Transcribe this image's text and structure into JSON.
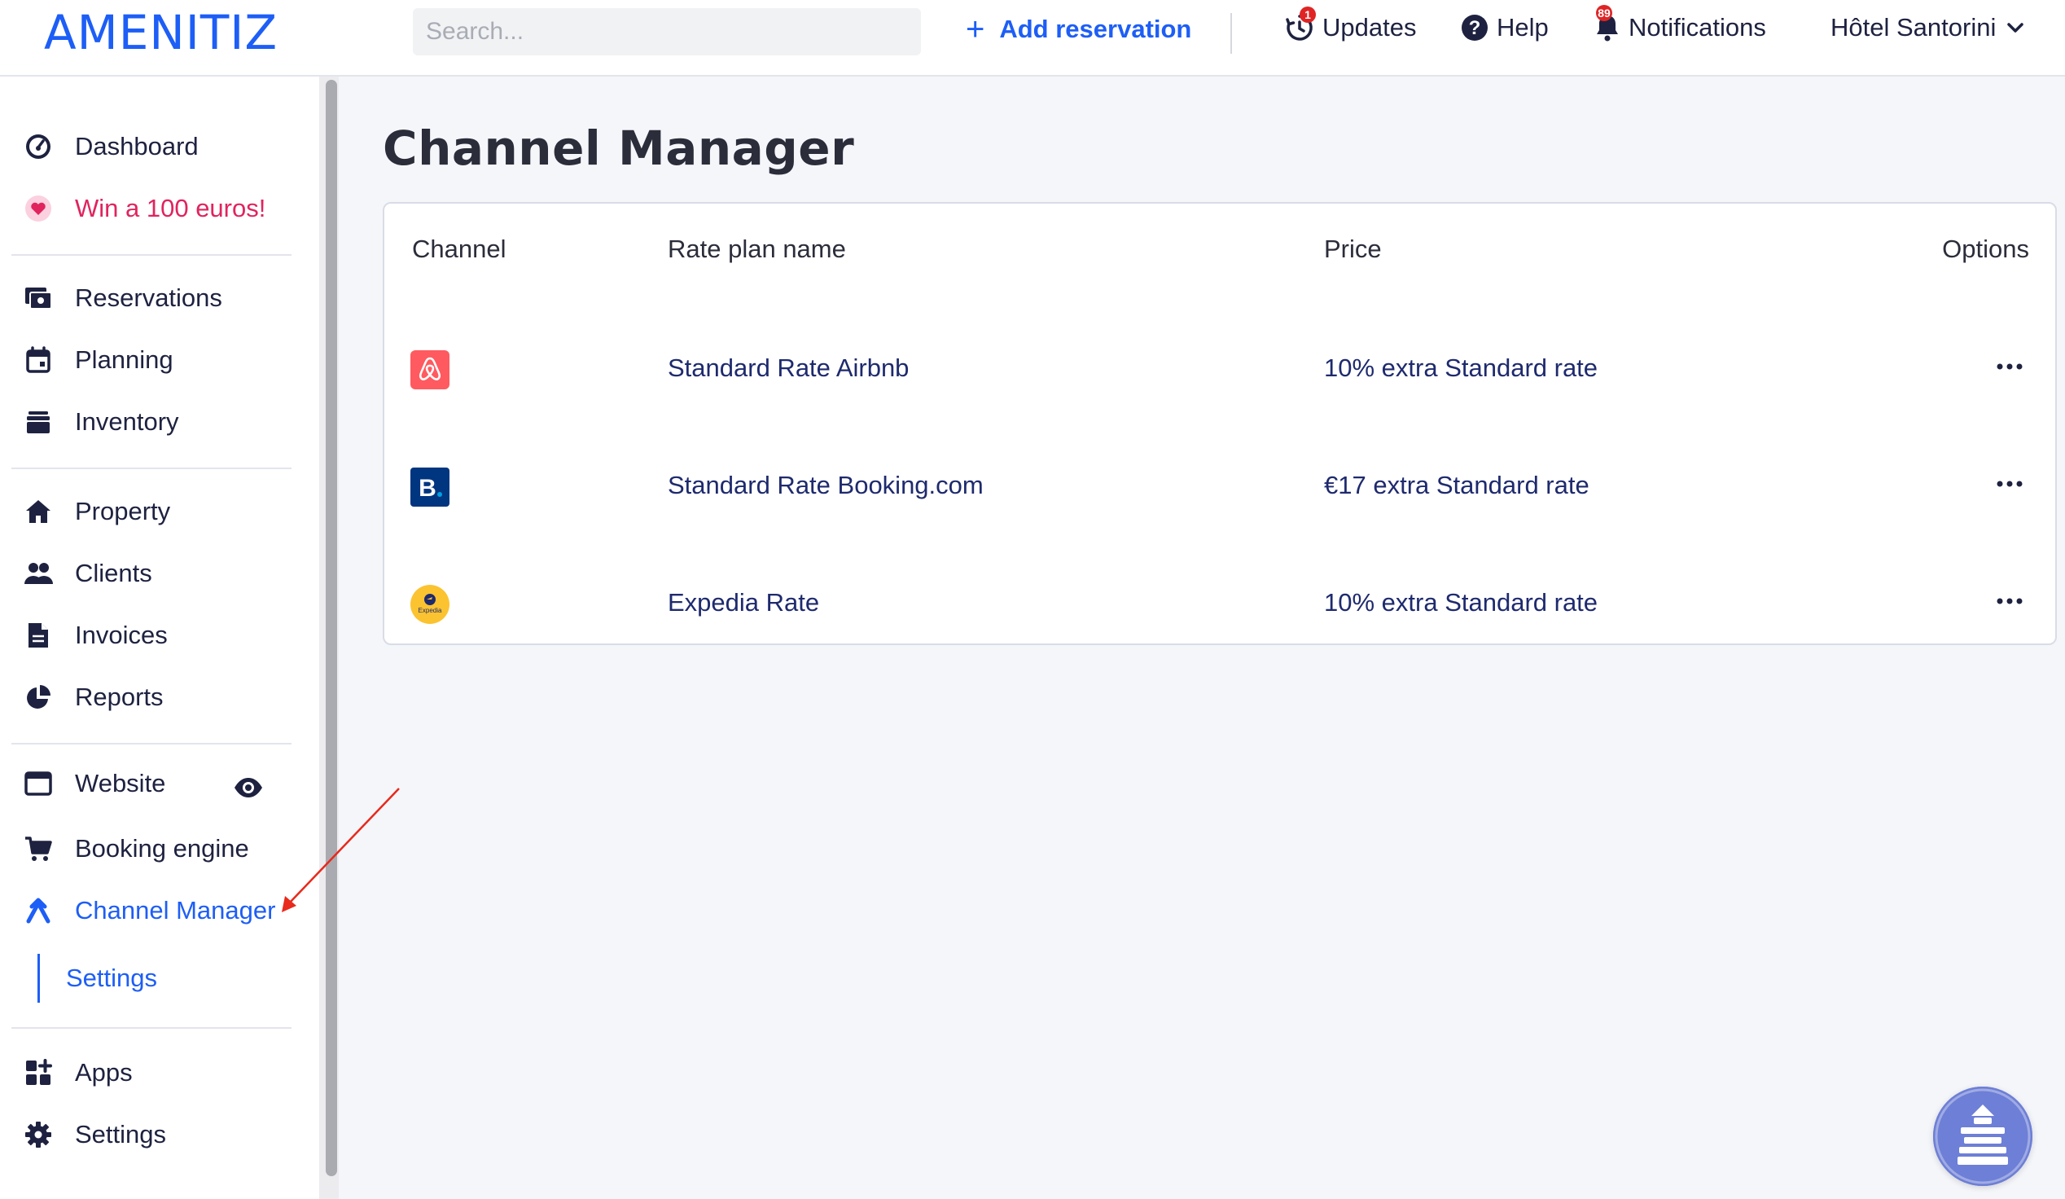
{
  "brand": {
    "logo_text": "AMENITIZ",
    "accent": "#1d5ef6",
    "promo_color": "#e0245e"
  },
  "topbar": {
    "search_placeholder": "Search...",
    "add_reservation": "Add reservation",
    "updates": {
      "label": "Updates",
      "badge": "1"
    },
    "help": "Help",
    "notifications": {
      "label": "Notifications",
      "badge": "89"
    },
    "hotel_name": "Hôtel Santorini"
  },
  "sidebar": {
    "items": [
      {
        "label": "Dashboard",
        "icon": "gauge-icon"
      },
      {
        "label": "Win a 100 euros!",
        "icon": "heart-icon"
      },
      {
        "label": "Reservations",
        "icon": "reservations-icon"
      },
      {
        "label": "Planning",
        "icon": "calendar-icon"
      },
      {
        "label": "Inventory",
        "icon": "inventory-icon"
      },
      {
        "label": "Property",
        "icon": "home-icon"
      },
      {
        "label": "Clients",
        "icon": "users-icon"
      },
      {
        "label": "Invoices",
        "icon": "invoice-icon"
      },
      {
        "label": "Reports",
        "icon": "pie-chart-icon"
      },
      {
        "label": "Website",
        "icon": "browser-window-icon"
      },
      {
        "label": "Booking engine",
        "icon": "cart-icon"
      },
      {
        "label": "Channel Manager",
        "icon": "channel-manager-icon",
        "active": true
      },
      {
        "label": "Apps",
        "icon": "apps-icon"
      },
      {
        "label": "Settings",
        "icon": "gear-icon"
      }
    ],
    "channel_manager_sub": {
      "label": "Settings"
    }
  },
  "main": {
    "title": "Channel Manager",
    "table": {
      "headers": {
        "channel": "Channel",
        "rate_plan": "Rate plan name",
        "price": "Price",
        "options": "Options"
      },
      "rows": [
        {
          "channel": "Airbnb",
          "channel_icon": "airbnb-logo-icon",
          "rate_plan": "Standard Rate Airbnb",
          "price": "10% extra Standard rate"
        },
        {
          "channel": "Booking.com",
          "channel_icon": "booking-logo-icon",
          "rate_plan": "Standard Rate Booking.com",
          "price": "€17 extra Standard rate"
        },
        {
          "channel": "Expedia",
          "channel_icon": "expedia-logo-icon",
          "rate_plan": "Expedia Rate",
          "price": "10% extra Standard rate",
          "logo_text": "Expedia"
        }
      ]
    }
  },
  "colors": {
    "airbnb": "#ff5a5f",
    "booking": "#003580",
    "expedia": "#fcc330",
    "badge": "#e02424",
    "annotation_arrow": "#e8291c",
    "chat_widget": "#6d7fd6"
  }
}
